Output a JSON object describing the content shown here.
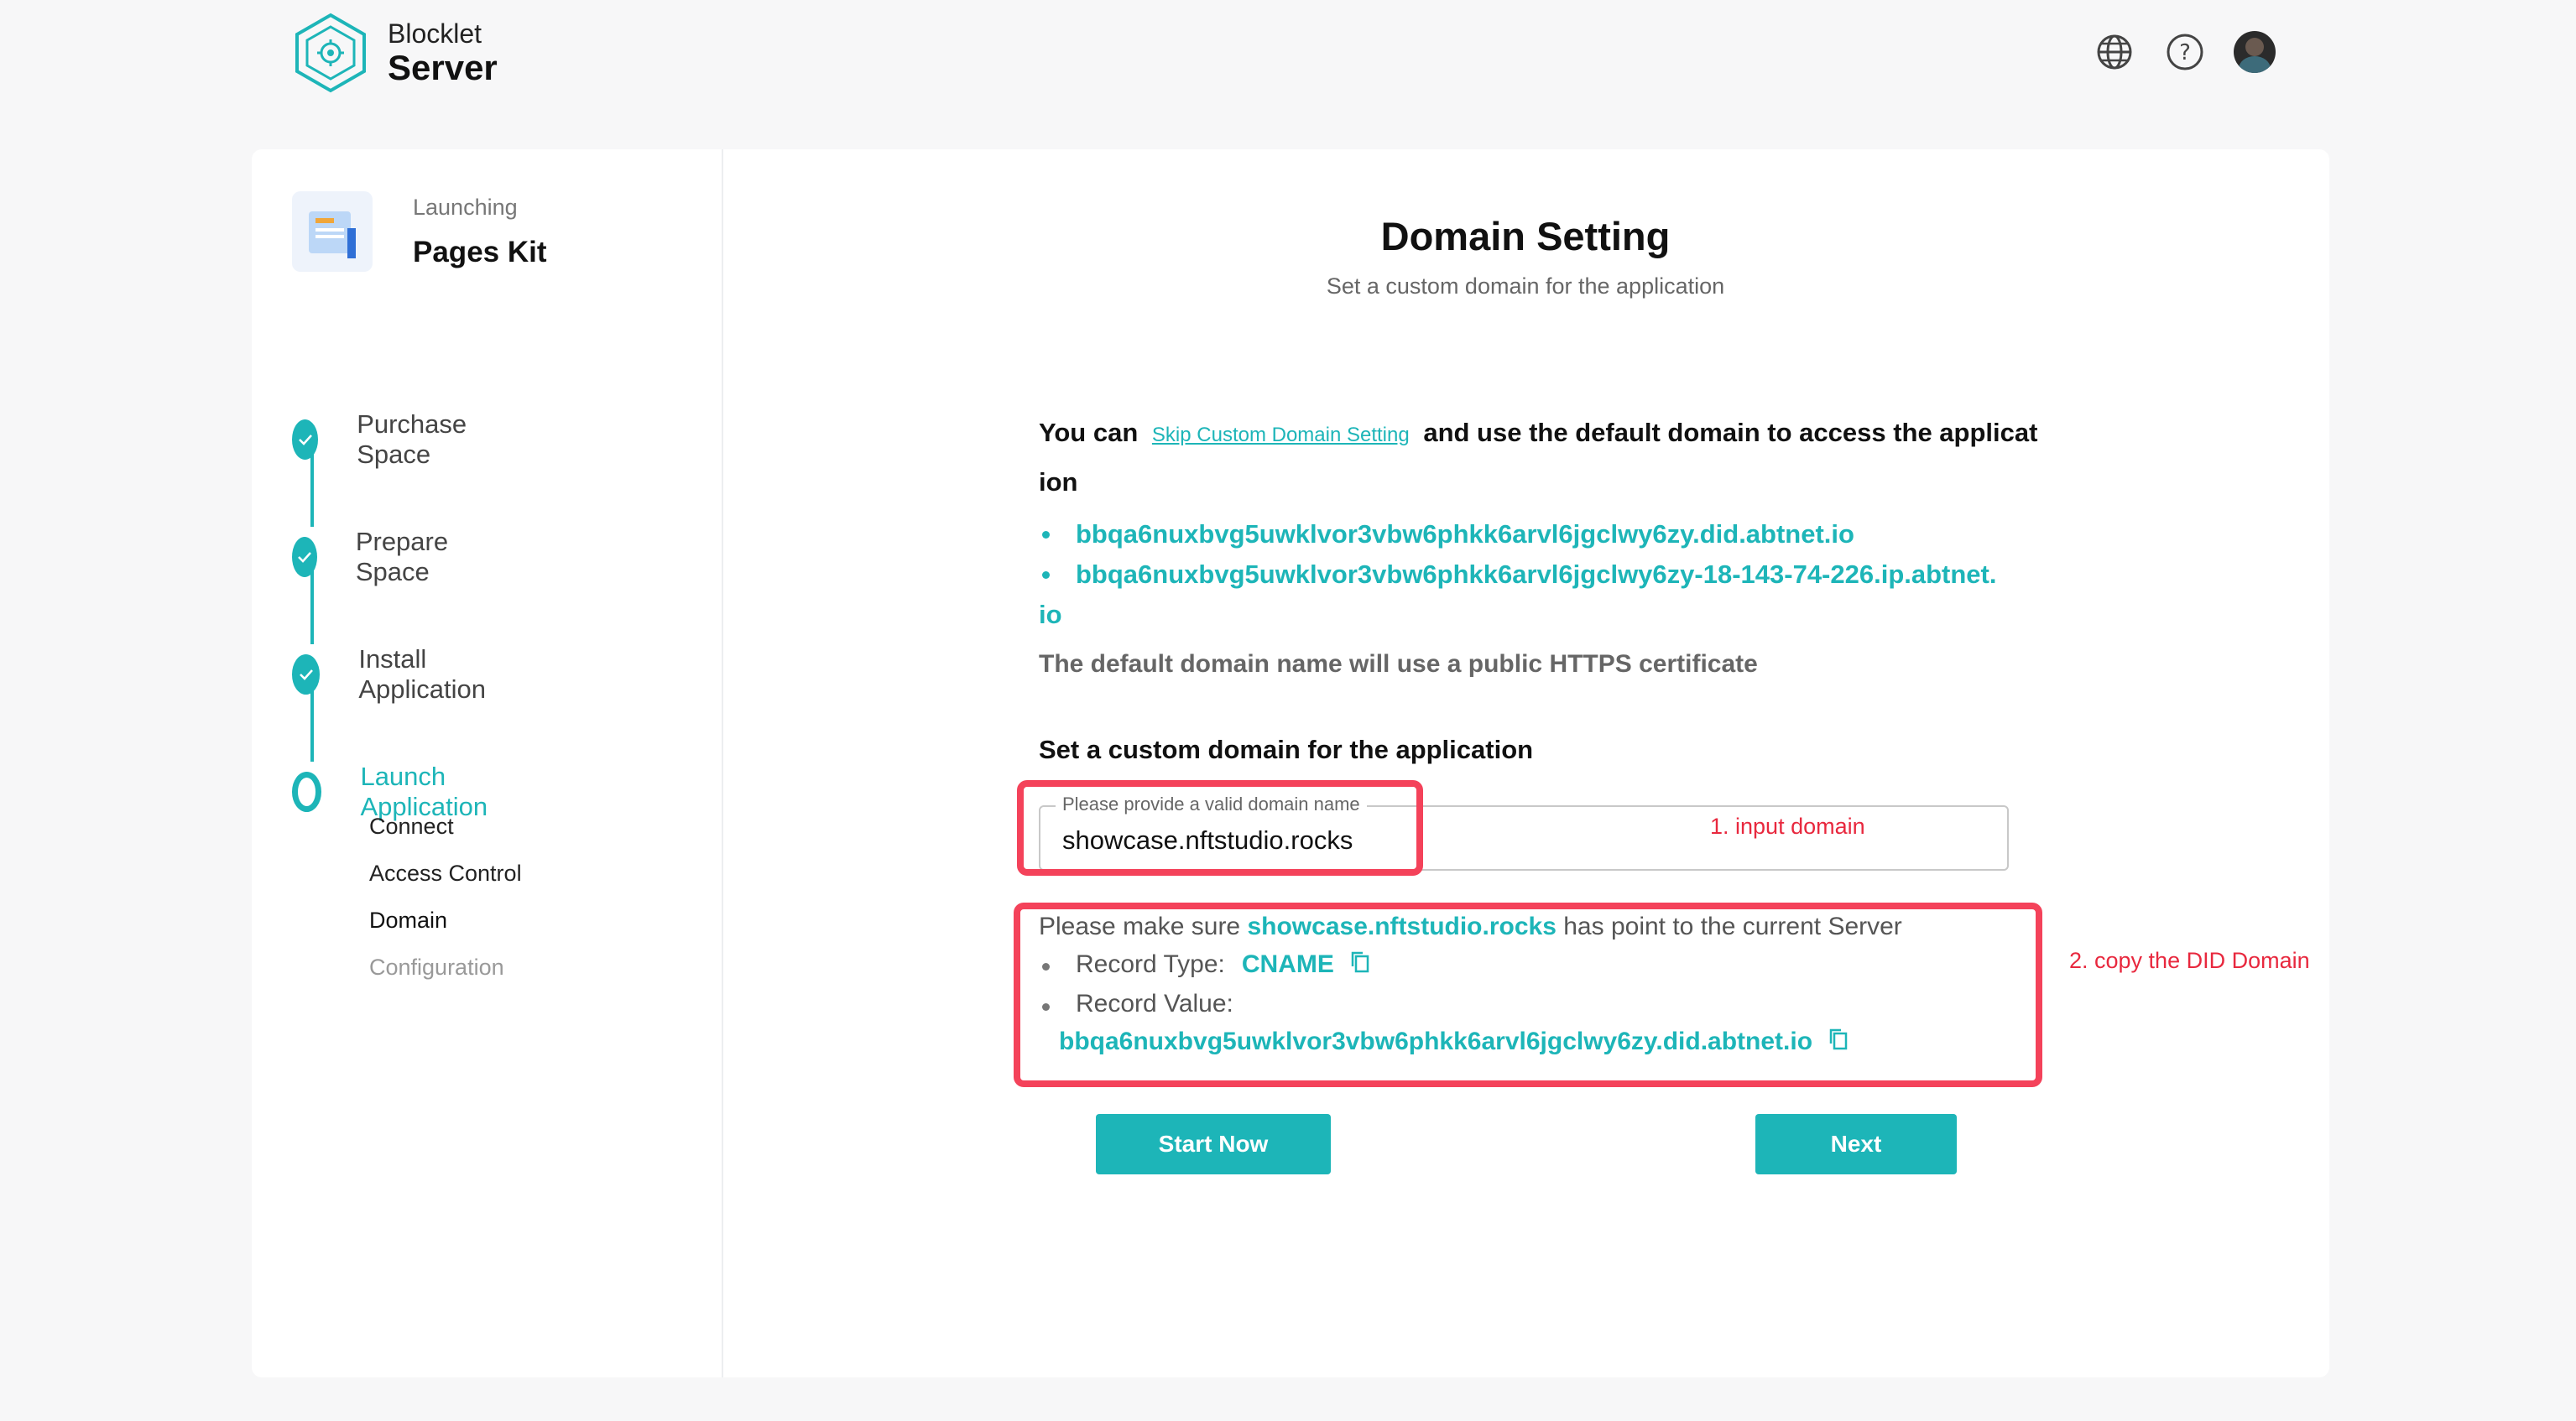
{
  "brand": {
    "line1": "Blocklet",
    "line2": "Server",
    "logo_icon": "blocklet-gear-hex-logo",
    "color": "#1db5b8"
  },
  "header": {
    "icons": [
      "globe-icon",
      "help-icon",
      "avatar"
    ]
  },
  "app": {
    "status": "Launching",
    "name": "Pages Kit"
  },
  "steps": [
    {
      "label": "Purchase Space",
      "state": "done"
    },
    {
      "label": "Prepare Space",
      "state": "done"
    },
    {
      "label": "Install Application",
      "state": "done"
    },
    {
      "label": "Launch Application",
      "state": "current"
    }
  ],
  "substeps": [
    {
      "label": "Connect"
    },
    {
      "label": "Access Control"
    },
    {
      "label": "Domain"
    },
    {
      "label": "Configuration"
    }
  ],
  "page": {
    "title": "Domain Setting",
    "subtitle": "Set a custom domain for the application"
  },
  "default_domain": {
    "prefix": "You can",
    "skip_link": "Skip Custom Domain Setting",
    "suffix_1": "and use the default domain to access the applicat",
    "suffix_2": "ion",
    "domain_1": "bbqa6nuxbvg5uwklvor3vbw6phkk6arvl6jgclwy6zy.did.abtnet.io",
    "domain_2a": "bbqa6nuxbvg5uwklvor3vbw6phkk6arvl6jgclwy6zy-18-143-74-226.ip.abtnet.",
    "domain_2b": "io",
    "note": "The default domain name will use a public HTTPS certificate"
  },
  "custom": {
    "heading": "Set a custom domain for the application",
    "field_label": "Please provide a valid domain name",
    "field_value": "showcase.nftstudio.rocks"
  },
  "hint": {
    "prefix": "Please make sure",
    "domain": "showcase.nftstudio.rocks",
    "suffix": "has point to the current Server",
    "record_type_label": "Record Type:",
    "record_type_value": "CNAME",
    "record_value_label": "Record Value:",
    "record_value": "bbqa6nuxbvg5uwklvor3vbw6phkk6arvl6jgclwy6zy.did.abtnet.io"
  },
  "annotations": {
    "a1": "1. input domain",
    "a2": "2. copy the DID Domain",
    "color": "#e8283e"
  },
  "buttons": {
    "start_now": "Start Now",
    "next": "Next"
  }
}
